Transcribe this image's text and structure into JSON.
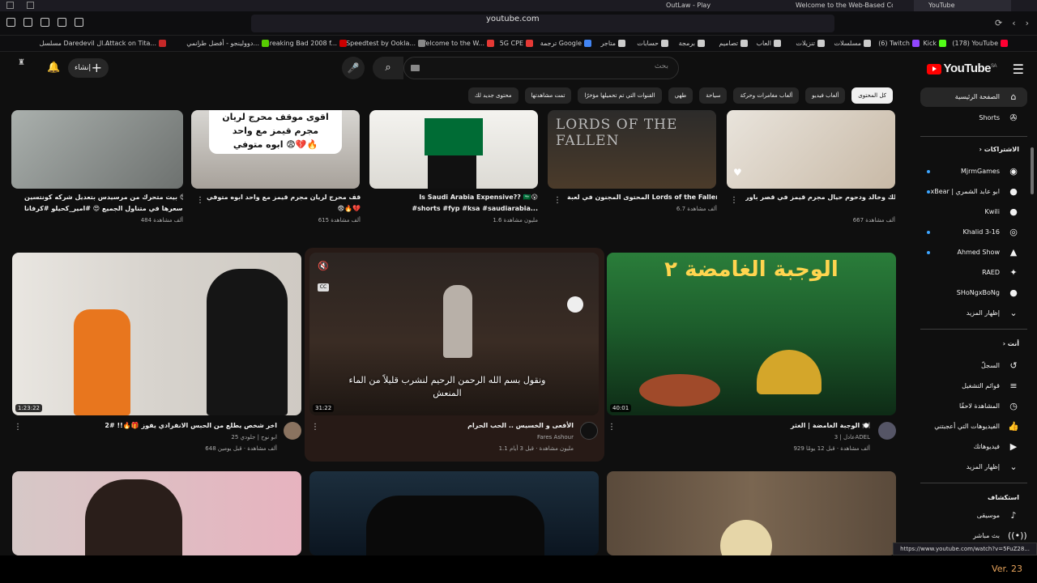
{
  "browser": {
    "tabs": [
      {
        "label": "OutLaw - Play",
        "active": false
      },
      {
        "label": "Welcome to the Web-Based Config...",
        "active": false
      },
      {
        "label": "YouTube",
        "active": true
      }
    ],
    "url": "youtube.com",
    "bookmarks": [
      "(178) YouTube",
      "Kick",
      "(6) Twitch",
      "مسلسلات",
      "تنزيلات",
      "العاب",
      "تصاميم",
      "برمجة",
      "حسابات",
      "متاجر",
      "ترجمة Google",
      "5G CPE",
      "Welcome to the W...",
      "Speedtest by Ookla...",
      "Breaking Bad 2008 f...",
      "دوولينجو - أفضل طر...",
      "انمي",
      "Attack on Tita...",
      "مسلسل Daredevil ال..."
    ],
    "status_url": "https://www.youtube.com/watch?v=5FuZ28..."
  },
  "youtube": {
    "logo": "YouTube",
    "region": "SA",
    "search_placeholder": "بحث",
    "create_label": "إنشاء",
    "chips": [
      "كل المحتوى",
      "ألعاب فيديو",
      "ألعاب مغامرات وحركة",
      "سياحة",
      "طهي",
      "القنوات التي تم تحميلها مؤخرًا",
      "تمت مشاهدتها",
      "محتوى جديد لك"
    ],
    "sidebar": {
      "home": "الصفحة الرئيسية",
      "shorts": "Shorts",
      "subs_header": "الاشتراكات",
      "subscriptions": [
        "MjrmGames",
        "xBear | ابو عابد الشمري",
        "Kwili",
        "Khalid 3-16",
        "Ahmed Show",
        "RAED",
        "SHoNgxBoNg"
      ],
      "show_more": "إظهار المزيد",
      "you_header": "أنت",
      "you_items": [
        "السجلّ",
        "قوائم التشغيل",
        "المشاهدة لاحقًا",
        "الفيديوهات التي أعجبتني",
        "فيديوهاتك",
        "إظهار المزيد"
      ],
      "explore_header": "استكشاف",
      "explore_items": [
        "موسيقى",
        "بث مباشر"
      ]
    },
    "top_row": [
      {
        "title": "ملك وخالد ودحوم حيال مجرم قيمز في قصر باور 😮💕",
        "meta": "667 ألف مشاهدة"
      },
      {
        "title": "المحتوى المجنون في لعبة Lords of the Fallen 2",
        "meta": "6.7 ألف مشاهدة"
      },
      {
        "title": "Is Saudi Arabia Expensive?? 🇸🇦😮",
        "title2": "#shorts #fyp #ksa #saudiarabia...",
        "meta": "1.6 مليون مشاهدة"
      },
      {
        "title": "اقوى مواقف محرج لريان مجرم قيمز مع واحد ابوه متوفي",
        "title2": "😨🔥💔",
        "meta": "615 ألف مشاهدة"
      },
      {
        "title": "بيت متحرك من مرسيدس بتعديل شركه كونتسين 😍",
        "title2": "سعرها في متناول الجميع 😍 #امير_كحيلو #كرفانا...",
        "meta": "484 ألف مشاهدة"
      }
    ],
    "top_thumb_texts": [
      "اقوى موقف محرج لريان",
      "مجرم قيمز مع واحد",
      "ابوه متوفي 😨💔🔥"
    ],
    "main_row": [
      {
        "title": "الوجبة الغامضة | الغثر 🍽️",
        "channel": "عادل | 3ADEL",
        "meta": "929 ألف مشاهدة · قبل 12 يومًا",
        "duration": "40:01",
        "thumb_text": "الوجبة الغامضة ٢"
      },
      {
        "title": "الأفعى و الخسيس .. الحب الحرام",
        "channel": "Fares Ashour",
        "meta": "1.1 مليون مشاهدة · قبل 3 أيام",
        "duration": "31:22",
        "subtitle": "ونقول بسم الله الرحمن الرحيم لنشرب قليلاً من الماء المنعش"
      },
      {
        "title": "اخر شخص يطلع من الحبس الانفرادي يفوز 🎁🔥!! #2",
        "channel": "ابو نوح | جلودي 25",
        "meta": "648 ألف مشاهدة · قبل يومين",
        "duration": "1:23:22"
      }
    ],
    "version": "Ver. 23"
  }
}
